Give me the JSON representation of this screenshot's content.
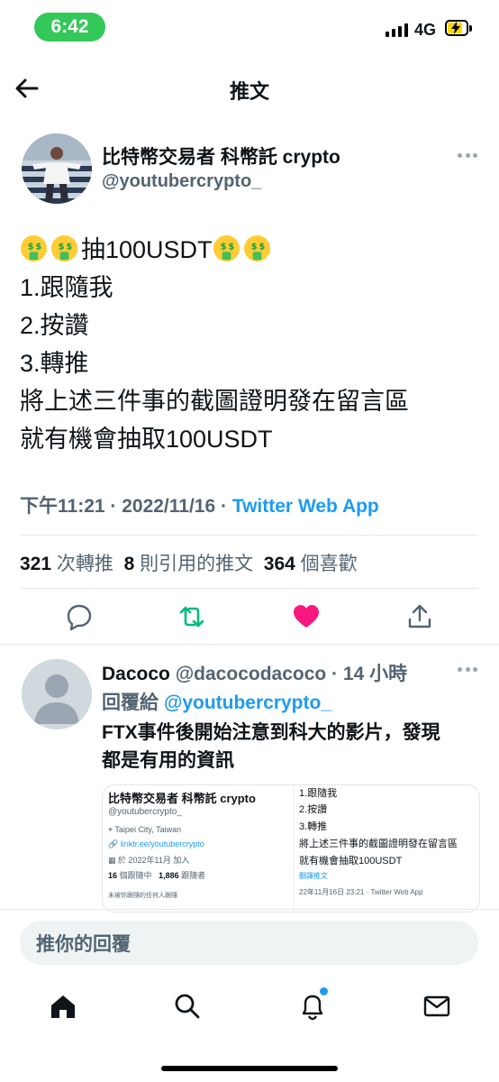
{
  "status_bar": {
    "time": "6:42",
    "network": "4G"
  },
  "header": {
    "title": "推文"
  },
  "tweet": {
    "author_name": "比特幣交易者 科幣託 crypto",
    "author_handle": "@youtubercrypto_",
    "lines": {
      "l1": "抽100USDT",
      "l2": "1.跟隨我",
      "l3": "2.按讚",
      "l4": "3.轉推",
      "l5": "將上述三件事的截圖證明發在留言區",
      "l6": "就有機會抽取100USDT"
    },
    "timestamp": "下午11:21 · 2022/11/16 · ",
    "source": "Twitter Web App",
    "stats": {
      "retweets": "321",
      "retweets_label": "次轉推",
      "quotes": "8",
      "quotes_label": "則引用的推文",
      "likes": "364",
      "likes_label": "個喜歡"
    }
  },
  "reply": {
    "name": "Dacoco",
    "handle_time": "@dacocodacoco · 14 小時",
    "replying_to_label": "回覆給",
    "replying_to_handle": "@youtubercrypto_",
    "text_l1": "FTX事件後開始注意到科大的影片，發現",
    "text_l2": "都是有用的資訊",
    "image": {
      "left": {
        "name": "比特幣交易者 科幣託 crypto",
        "handle": "@youtubercrypto_",
        "location": "Taipei City, Taiwan",
        "link": "linktr.ee/youtubercrypto",
        "joined": "於 2022年11月 加入",
        "following_count": "16",
        "following_label": "個跟隨中",
        "followers_count": "1,886",
        "followers_label": "跟隨者",
        "note": "未被你跟隨的任何人跟隨"
      },
      "right": {
        "l1": "1.跟隨我",
        "l2": "2.按讚",
        "l3": "3.轉推",
        "l4": "將上述三件事的截圖證明發在留言區",
        "l5": "就有機會抽取100USDT",
        "translate": "翻譯推文",
        "meta": "22年11月16日 23:21 · Twitter Web App"
      }
    }
  },
  "composer": {
    "placeholder": "推你的回覆"
  },
  "colors": {
    "accent": "#1d9bf0",
    "like": "#f91880",
    "retweet": "#00ba7c",
    "status_pill": "#34c759"
  },
  "icons": [
    "back-arrow-icon",
    "more-icon",
    "money-face-emoji",
    "reply-icon",
    "retweet-icon",
    "like-icon",
    "share-icon",
    "home-icon",
    "search-icon",
    "notifications-icon",
    "messages-icon"
  ]
}
